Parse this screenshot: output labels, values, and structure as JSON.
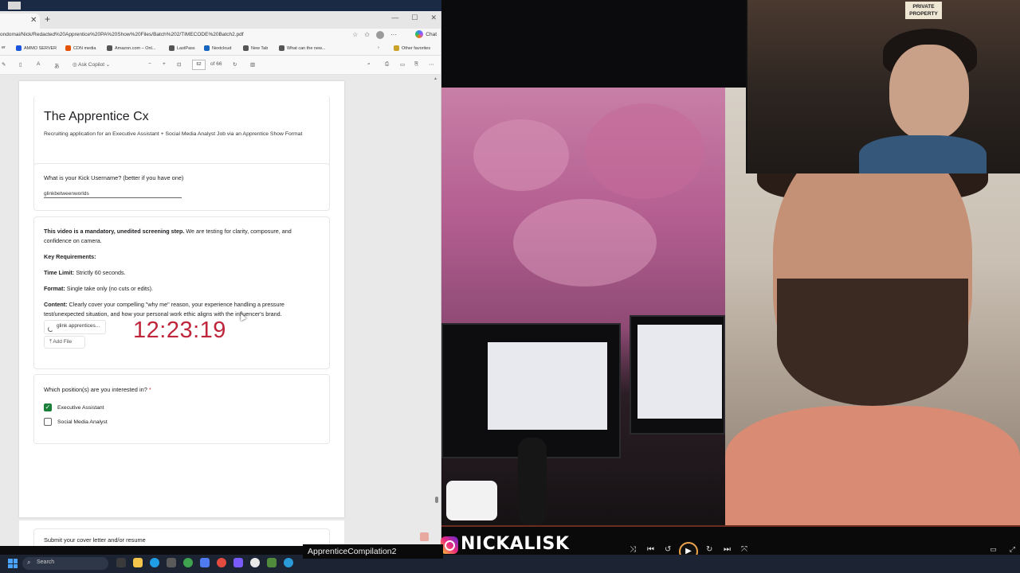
{
  "browser": {
    "url": "ondomai/Nick/Redacted%20Apprentice%20PA%20Show%20Files/Batch%202/TIMECODE%20Batch2.pdf",
    "chat_label": "Chat",
    "favorites": [
      {
        "label": "AMMO SERVER",
        "color": "#1a56db"
      },
      {
        "label": "CDN media",
        "color": "#e65100"
      },
      {
        "label": "Amazon.com – Onl...",
        "color": "#555555"
      },
      {
        "label": "LastPass",
        "color": "#555555"
      },
      {
        "label": "Nextcloud",
        "color": "#1565c0"
      },
      {
        "label": "New Tab",
        "color": "#555555"
      },
      {
        "label": "What can the new...",
        "color": "#555555"
      }
    ],
    "other_favorites": "Other favorites",
    "pdf_toolbar": {
      "ask_copilot": "Ask Copilot",
      "page_current": "62",
      "page_total": "of 66"
    }
  },
  "form": {
    "title": "The Apprentice Cx",
    "subtitle": "Recruiting application for an Executive Assistant + Social Media Analyst Job via an Apprentice Show Format",
    "kick_question": "What is your Kick Username? (better if you have one)",
    "kick_answer": "glinkbetweenworlds",
    "video_intro_bold": "This video is a mandatory, unedited screening step.",
    "video_intro_rest": " We are testing for clarity, composure, and confidence on camera.",
    "key_requirements": "Key Requirements:",
    "time_limit_label": "Time Limit:",
    "time_limit_value": " Strictly 60 seconds.",
    "format_label": "Format:",
    "format_value": " Single take only (no cuts or edits).",
    "content_label": "Content:",
    "content_value": " Clearly cover your compelling \"why me\" reason, your experience handling a pressure test/unexpected situation, and how your personal work ethic aligns with the influencer's brand.",
    "file_chip": "glink apprentices...",
    "add_file": "Add File",
    "timecode": "12:23:19",
    "position_question": "Which position(s) are you interested in?",
    "required_mark": "*",
    "options": [
      {
        "label": "Executive Assistant",
        "checked": true
      },
      {
        "label": "Social Media Analyst",
        "checked": false
      }
    ],
    "next_question": "Submit your cover letter and/or resume"
  },
  "video": {
    "handle": "NICKALISK",
    "title": "ApprenticeCompilation2",
    "sign_text": "PRIVATE PROPERTY",
    "progress": 0.0
  },
  "taskbar": {
    "search_placeholder": "Search"
  }
}
